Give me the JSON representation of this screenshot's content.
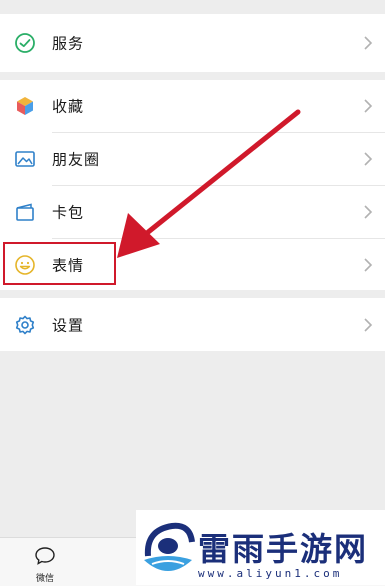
{
  "menu": {
    "services_label": "服务",
    "favorites_label": "收藏",
    "moments_label": "朋友圈",
    "cards_label": "卡包",
    "stickers_label": "表情",
    "settings_label": "设置"
  },
  "tabbar": {
    "chats_label": "微信"
  },
  "watermark": {
    "title": "雷雨手游网",
    "url": "www.aliyun1.com"
  },
  "colors": {
    "highlight": "#d0192b",
    "wechat_green": "#2aae67",
    "watermark_blue": "#1b2f7a"
  }
}
